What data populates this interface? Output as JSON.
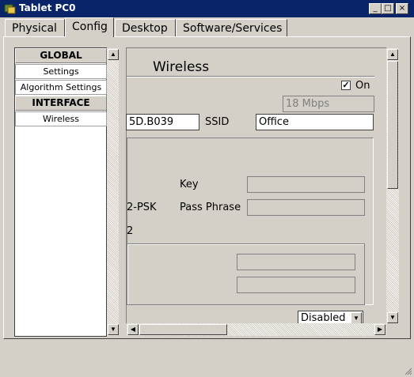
{
  "window": {
    "title": "Tablet PC0",
    "controls": {
      "minimize": "_",
      "maximize": "□",
      "close": "×"
    }
  },
  "tabs": [
    {
      "label": "Physical",
      "active": false
    },
    {
      "label": "Config",
      "active": true
    },
    {
      "label": "Desktop",
      "active": false
    },
    {
      "label": "Software/Services",
      "active": false
    }
  ],
  "sidebar": {
    "global_header": "GLOBAL",
    "items_global": [
      "Settings",
      "Algorithm Settings"
    ],
    "interface_header": "INTERFACE",
    "items_interface": [
      "Wireless"
    ]
  },
  "wireless": {
    "title": "Wireless",
    "port_status_label": "On",
    "port_status_checked": true,
    "bandwidth_value": "18 Mbps",
    "mac_value": "5D.B039",
    "ssid_label": "SSID",
    "ssid_value": "Office",
    "key_label": "Key",
    "key_value": "",
    "passphrase_label": "Pass Phrase",
    "passphrase_value": "",
    "auth_partial": "2-PSK",
    "encryption_partial": "2",
    "field_a_value": "",
    "field_b_value": "",
    "encryption_select": "Disabled"
  }
}
